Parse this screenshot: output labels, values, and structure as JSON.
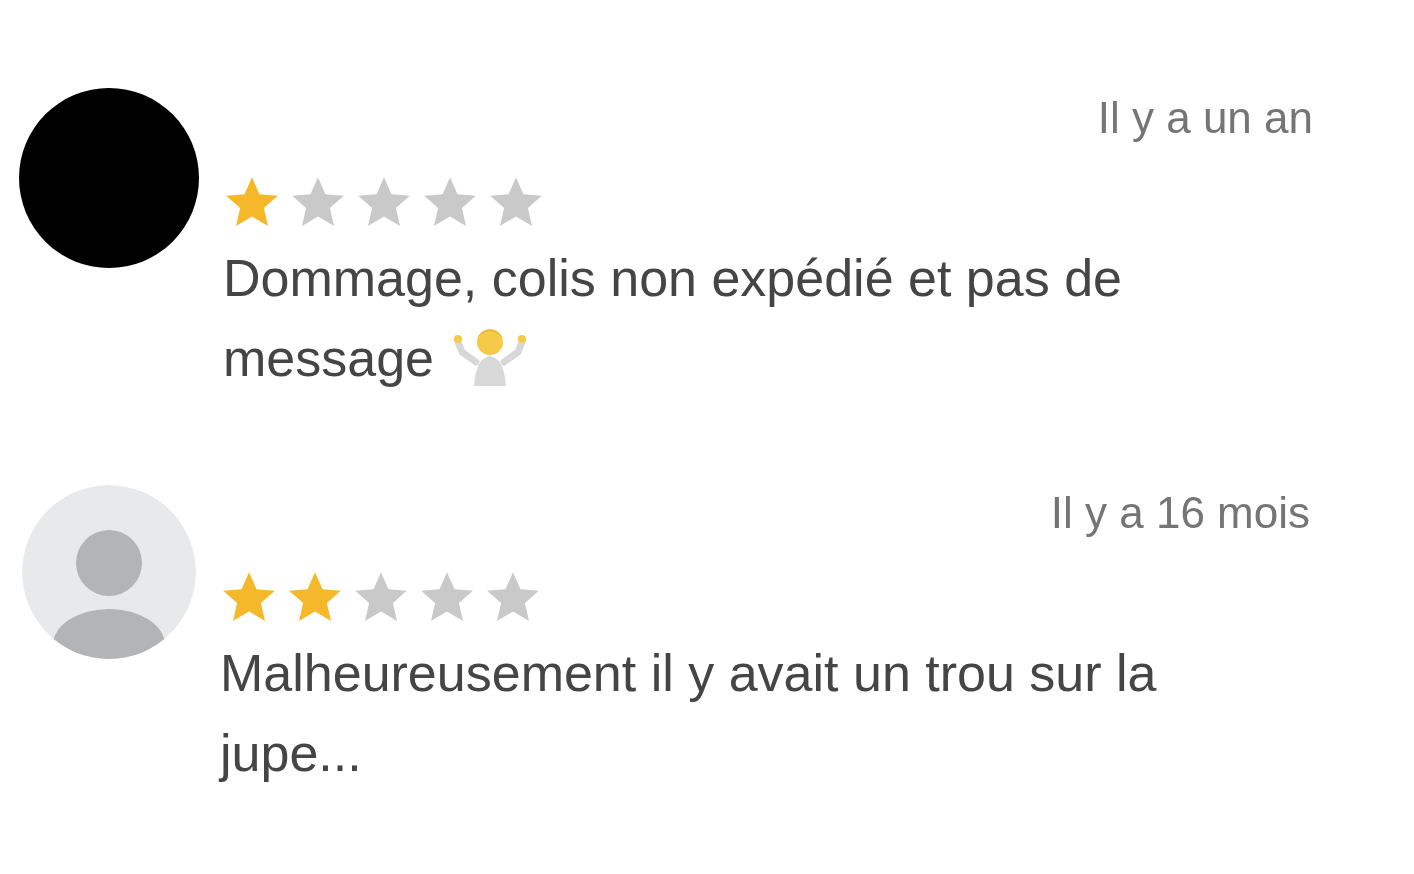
{
  "reviews": [
    {
      "kind": "solid",
      "time": "Il y a un an",
      "stars": 1,
      "text": "Dommage, colis non expédié et pas de message",
      "emoji": true
    },
    {
      "kind": "placeholder",
      "time": "Il y a 16 mois",
      "stars": 2,
      "text": "Malheureusement il y avait un trou sur la jupe...",
      "emoji": false
    }
  ]
}
